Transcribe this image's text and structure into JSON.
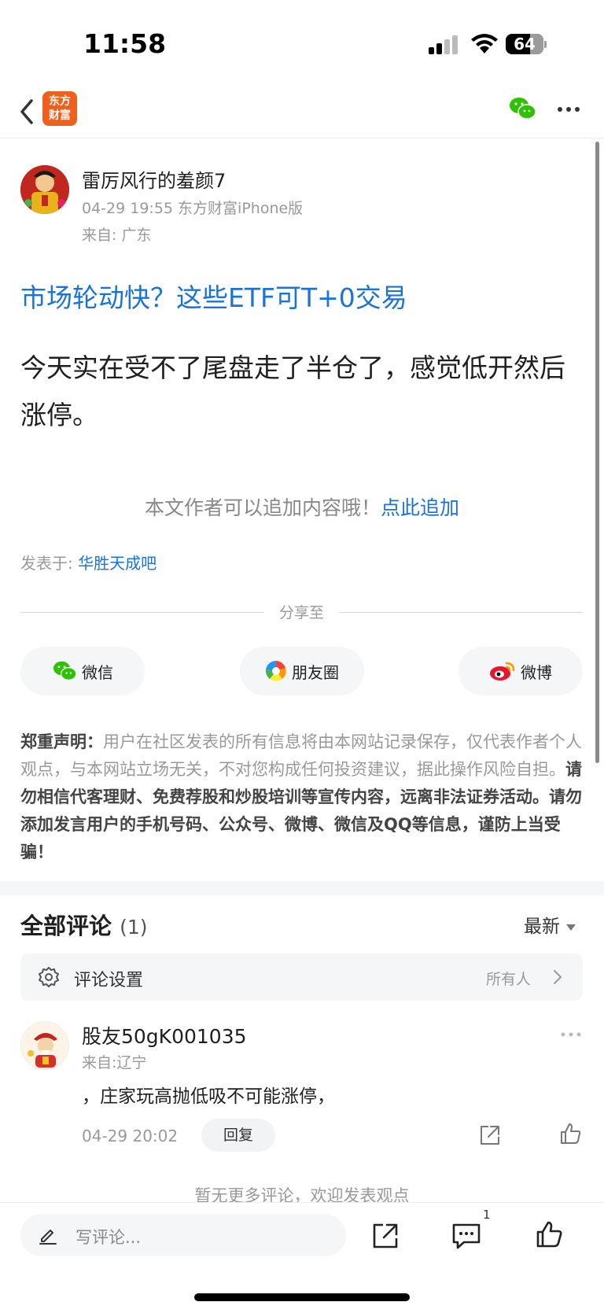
{
  "status_bar": {
    "time": "11:58",
    "battery_level": "64",
    "battery_fraction": 0.64
  },
  "nav": {
    "logo_line1": "东方",
    "logo_line2": "财富",
    "brand_color": "#f0601d",
    "wechat_color": "#2dc100"
  },
  "post": {
    "author_name": "雷厉风行的羞颜7",
    "meta": "04-29 19:55 东方财富iPhone版",
    "location": "来自: 广东",
    "promo_link": "市场轮动快？这些ETF可T+0交易",
    "body": "今天实在受不了尾盘走了半仓了，感觉低开然后涨停。",
    "append_hint": "本文作者可以追加内容哦！",
    "append_link": "点此追加",
    "published_in_label": "发表于: ",
    "bar_name": "华胜天成吧",
    "link_color": "#1a73d9"
  },
  "share": {
    "label": "分享至",
    "buttons": [
      {
        "label": "微信",
        "icon": "wechat-icon"
      },
      {
        "label": "朋友圈",
        "icon": "moments-icon"
      },
      {
        "label": "微博",
        "icon": "weibo-icon"
      }
    ]
  },
  "disclaimer": {
    "heading": "郑重声明：",
    "normal": "用户在社区发表的所有信息将由本网站记录保存，仅代表作者个人观点，与本网站立场无关，不对您构成任何投资建议，据此操作风险自担。",
    "bold": "请勿相信代客理财、免费荐股和炒股培训等宣传内容，远离非法证券活动。请勿添加发言用户的手机号码、公众号、微博、微信及QQ等信息，谨防上当受骗！"
  },
  "comments": {
    "title": "全部评论",
    "count": "(1)",
    "sort": "最新",
    "settings_label": "评论设置",
    "settings_value": "所有人",
    "items": [
      {
        "user": "股友50gK001035",
        "location": "来自:辽宁",
        "text": "，庄家玩高抛低吸不可能涨停，",
        "date": "04-29 20:02",
        "reply_label": "回复"
      }
    ],
    "no_more": "暂无更多评论，欢迎发表观点"
  },
  "bottom_bar": {
    "input_placeholder": "写评论...",
    "comment_badge": "1"
  }
}
